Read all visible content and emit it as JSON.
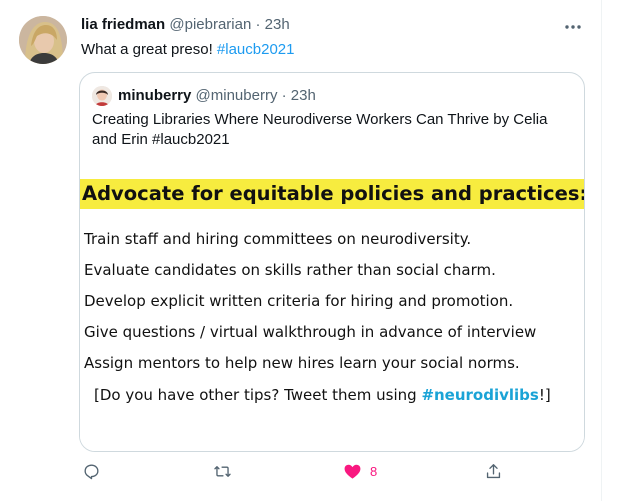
{
  "tweet": {
    "display_name": "lia friedman",
    "handle": "@piebrarian",
    "separator": "·",
    "time": "23h",
    "text": "What a great preso!",
    "hashtag": "#laucb2021"
  },
  "quote": {
    "display_name": "minuberry",
    "handle": "@minuberry",
    "separator": "·",
    "time": "23h",
    "text": "Creating Libraries Where Neurodiverse Workers Can Thrive by Celia and Erin  #laucb2021",
    "image": {
      "heading": "Advocate for equitable policies and practices:",
      "lines": [
        "Train staff and hiring committees on neurodiversity.",
        "Evaluate candidates on skills rather than social charm.",
        "Develop explicit written criteria for hiring and promotion.",
        "Give questions / virtual walkthrough in advance of interview",
        "Assign mentors to help new hires learn your social norms."
      ],
      "closing_prefix": "[Do you have other tips? Tweet them using ",
      "closing_tag": "#neurodivlibs",
      "closing_suffix": "!]",
      "highlight_color": "#f7ec3f"
    }
  },
  "actions": {
    "reply_icon": "reply-icon",
    "retweet_icon": "retweet-icon",
    "like_icon": "heart-filled-icon",
    "like_count": "8",
    "like_color": "#f91880",
    "share_icon": "share-icon"
  },
  "colors": {
    "link": "#1d9bf0",
    "secondary_text": "#536471",
    "border": "#cfd9de"
  }
}
